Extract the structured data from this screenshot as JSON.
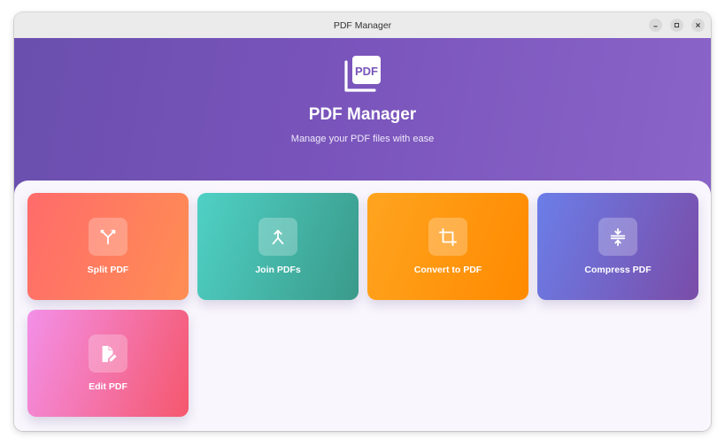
{
  "window": {
    "title": "PDF Manager"
  },
  "header": {
    "logo_text": "PDF",
    "title": "PDF Manager",
    "subtitle": "Manage your PDF files with ease"
  },
  "cards": [
    {
      "label": "Split PDF",
      "icon": "split-icon",
      "gradient": [
        "#ff6b6b",
        "#ff8e53"
      ]
    },
    {
      "label": "Join PDFs",
      "icon": "merge-icon",
      "gradient": [
        "#4fd1c5",
        "#3a9a8a"
      ]
    },
    {
      "label": "Convert to PDF",
      "icon": "crop-icon",
      "gradient": [
        "#ffa41f",
        "#ff8a00"
      ]
    },
    {
      "label": "Compress PDF",
      "icon": "compress-icon",
      "gradient": [
        "#6b7ee8",
        "#7a4ca8"
      ]
    },
    {
      "label": "Edit PDF",
      "icon": "edit-document-icon",
      "gradient": [
        "#f390e8",
        "#f5576c"
      ]
    }
  ],
  "colors": {
    "accent": "#7954bb",
    "background": "#f9f6fd"
  }
}
